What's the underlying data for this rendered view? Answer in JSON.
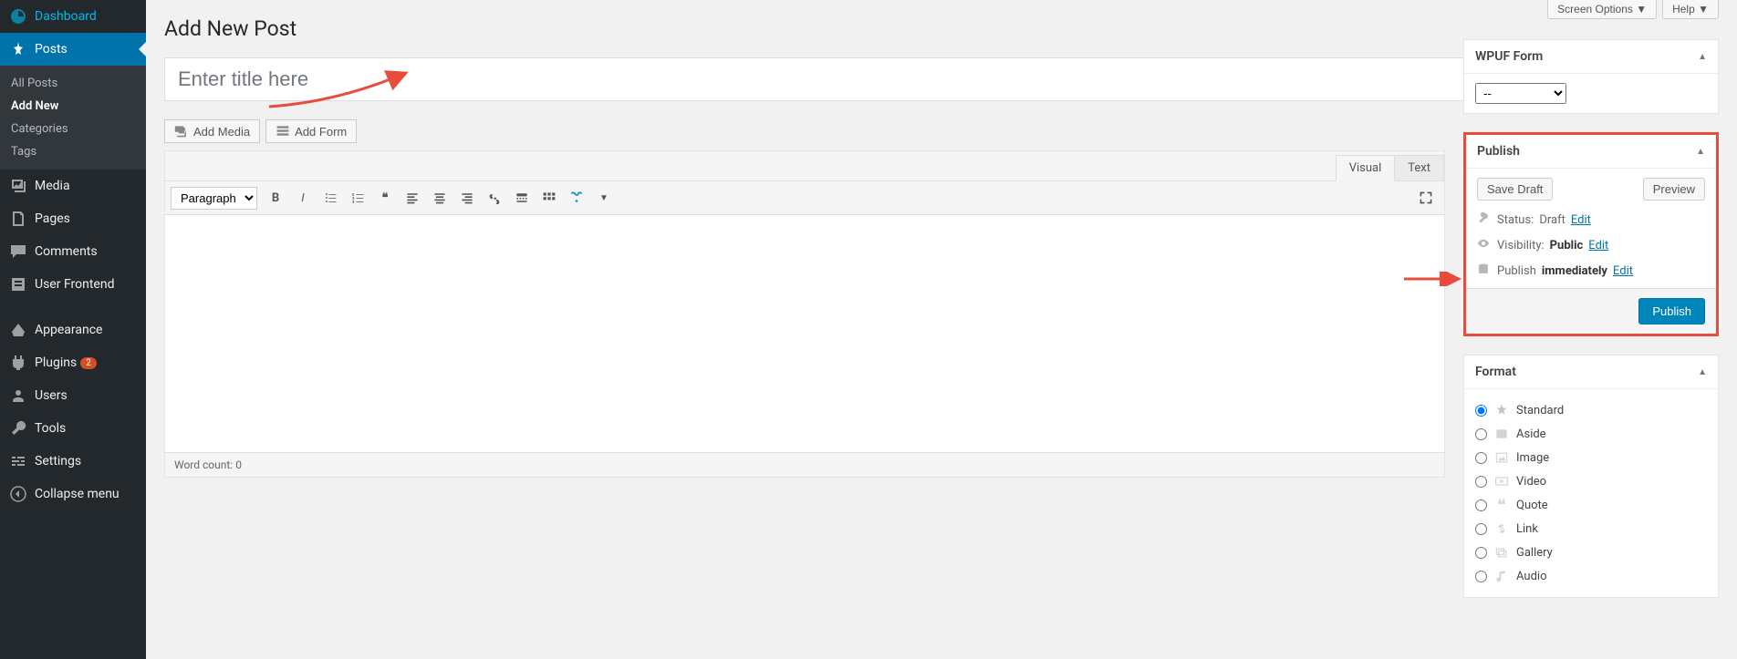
{
  "screen_options": {
    "screen_label": "Screen Options",
    "help_label": "Help"
  },
  "page_title": "Add New Post",
  "title_placeholder": "Enter title here",
  "sidebar": {
    "items": [
      {
        "label": "Dashboard",
        "icon": "dashboard"
      },
      {
        "label": "Posts",
        "icon": "pin",
        "current": true,
        "submenu": [
          {
            "label": "All Posts"
          },
          {
            "label": "Add New",
            "current": true
          },
          {
            "label": "Categories"
          },
          {
            "label": "Tags"
          }
        ]
      },
      {
        "label": "Media",
        "icon": "media"
      },
      {
        "label": "Pages",
        "icon": "pages"
      },
      {
        "label": "Comments",
        "icon": "comments"
      },
      {
        "label": "User Frontend",
        "icon": "userfront"
      },
      {
        "label": "Appearance",
        "icon": "appearance"
      },
      {
        "label": "Plugins",
        "icon": "plugins",
        "badge": "2"
      },
      {
        "label": "Users",
        "icon": "users"
      },
      {
        "label": "Tools",
        "icon": "tools"
      },
      {
        "label": "Settings",
        "icon": "settings"
      },
      {
        "label": "Collapse menu",
        "icon": "collapse"
      }
    ]
  },
  "media_buttons": {
    "add_media": "Add Media",
    "add_form": "Add Form"
  },
  "editor": {
    "visual_tab": "Visual",
    "text_tab": "Text",
    "format_select": "Paragraph",
    "word_count_label": "Word count:",
    "word_count": "0"
  },
  "wpuf_box": {
    "title": "WPUF Form",
    "selected": "--"
  },
  "publish_box": {
    "title": "Publish",
    "save_draft": "Save Draft",
    "preview": "Preview",
    "status_label": "Status:",
    "status_value": "Draft",
    "visibility_label": "Visibility:",
    "visibility_value": "Public",
    "schedule_label": "Publish",
    "schedule_value": "immediately",
    "edit": "Edit",
    "publish_button": "Publish"
  },
  "format_box": {
    "title": "Format",
    "options": [
      {
        "label": "Standard",
        "checked": true
      },
      {
        "label": "Aside"
      },
      {
        "label": "Image"
      },
      {
        "label": "Video"
      },
      {
        "label": "Quote"
      },
      {
        "label": "Link"
      },
      {
        "label": "Gallery"
      },
      {
        "label": "Audio"
      }
    ]
  }
}
